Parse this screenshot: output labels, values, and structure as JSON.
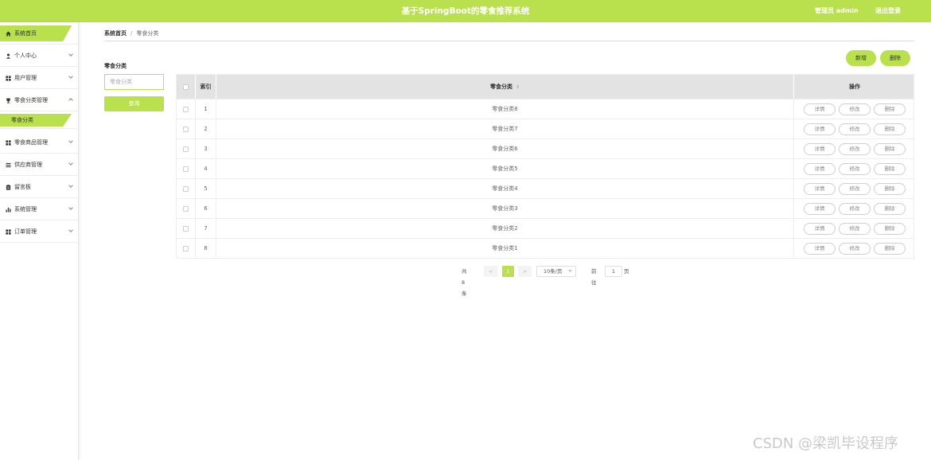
{
  "header": {
    "title": "基于SpringBoot的零食推荐系统",
    "user": "管理员 admin",
    "logout": "退出登录"
  },
  "sidebar": {
    "items": [
      {
        "label": "系统首页",
        "icon": "home-icon"
      },
      {
        "label": "个人中心",
        "icon": "user-icon"
      },
      {
        "label": "用户管理",
        "icon": "grid-icon"
      },
      {
        "label": "零食分类管理",
        "icon": "trophy-icon"
      },
      {
        "label": "零食分类",
        "icon": ""
      },
      {
        "label": "零食商品管理",
        "icon": "grid-icon"
      },
      {
        "label": "供应商管理",
        "icon": "list-icon"
      },
      {
        "label": "留言板",
        "icon": "clipboard-icon"
      },
      {
        "label": "系统管理",
        "icon": "bar-chart-icon"
      },
      {
        "label": "订单管理",
        "icon": "grid-icon"
      }
    ]
  },
  "breadcrumb": {
    "home": "系统首页",
    "separator": "/",
    "current": "零食分类"
  },
  "filter": {
    "label": "零食分类",
    "placeholder": "零食分类",
    "query": "查询"
  },
  "actions": {
    "add": "新增",
    "delete": "删除"
  },
  "table": {
    "headers": {
      "index": "索引",
      "name": "零食分类",
      "ops": "操作"
    },
    "op_labels": {
      "detail": "详情",
      "edit": "修改",
      "delete": "删除"
    },
    "rows": [
      {
        "index": "1",
        "name": "零食分类8"
      },
      {
        "index": "2",
        "name": "零食分类7"
      },
      {
        "index": "3",
        "name": "零食分类6"
      },
      {
        "index": "4",
        "name": "零食分类5"
      },
      {
        "index": "5",
        "name": "零食分类4"
      },
      {
        "index": "6",
        "name": "零食分类3"
      },
      {
        "index": "7",
        "name": "零食分类2"
      },
      {
        "index": "8",
        "name": "零食分类1"
      }
    ]
  },
  "pagination": {
    "total": "共 8 条",
    "prev": "<",
    "page": "1",
    "next": ">",
    "page_size": "10条/页",
    "goto": "前往",
    "goto_value": "1",
    "page_unit": "页"
  },
  "watermark": "CSDN @梁凯毕设程序",
  "colors": {
    "accent": "#b9e04d"
  }
}
